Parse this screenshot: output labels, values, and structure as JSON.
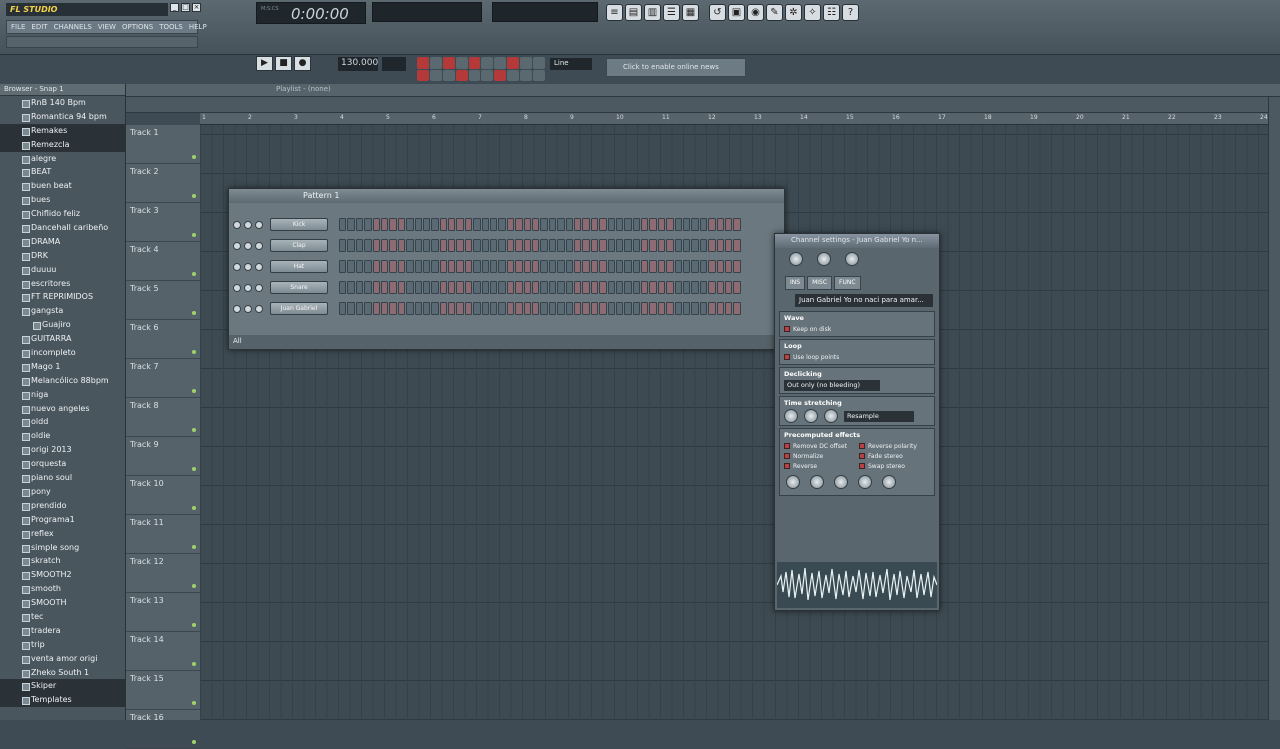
{
  "app": {
    "title": "FL STUDIO",
    "menu": [
      "FILE",
      "EDIT",
      "CHANNELS",
      "VIEW",
      "OPTIONS",
      "TOOLS",
      "HELP"
    ],
    "time": "0:00:00"
  },
  "toolbar": {
    "tempo": "130.000",
    "line_mode": "Line",
    "hint": "Click to enable online news"
  },
  "browser": {
    "title": "Browser - Snap 1",
    "items": [
      {
        "label": "RnB 140 Bpm",
        "type": "file"
      },
      {
        "label": "Romantica 94 bpm",
        "type": "file"
      },
      {
        "label": "Remakes",
        "type": "folder",
        "highlight": true
      },
      {
        "label": "Remezcla",
        "type": "folder",
        "highlight": true
      },
      {
        "label": "alegre",
        "type": "file"
      },
      {
        "label": "BEAT",
        "type": "file"
      },
      {
        "label": "buen beat",
        "type": "file"
      },
      {
        "label": "bues",
        "type": "file"
      },
      {
        "label": "Chiflido feliz",
        "type": "file"
      },
      {
        "label": "Dancehall caribeño",
        "type": "file"
      },
      {
        "label": "DRAMA",
        "type": "file"
      },
      {
        "label": "DRK",
        "type": "file"
      },
      {
        "label": "duuuu",
        "type": "file"
      },
      {
        "label": "escritores",
        "type": "file"
      },
      {
        "label": "FT REPRIMIDOS",
        "type": "file"
      },
      {
        "label": "gangsta",
        "type": "file"
      },
      {
        "label": "Guajiro",
        "type": "file",
        "sub": true
      },
      {
        "label": "GUITARRA",
        "type": "file"
      },
      {
        "label": "incompleto",
        "type": "file"
      },
      {
        "label": "Mago 1",
        "type": "file"
      },
      {
        "label": "Melancólico 88bpm",
        "type": "file"
      },
      {
        "label": "niga",
        "type": "file"
      },
      {
        "label": "nuevo angeles",
        "type": "file"
      },
      {
        "label": "oldd",
        "type": "file"
      },
      {
        "label": "oldie",
        "type": "file"
      },
      {
        "label": "origi 2013",
        "type": "file"
      },
      {
        "label": "orquesta",
        "type": "file"
      },
      {
        "label": "piano soul",
        "type": "file"
      },
      {
        "label": "pony",
        "type": "file"
      },
      {
        "label": "prendido",
        "type": "file"
      },
      {
        "label": "Programa1",
        "type": "file"
      },
      {
        "label": "reflex",
        "type": "file"
      },
      {
        "label": "simple song",
        "type": "file"
      },
      {
        "label": "skratch",
        "type": "file"
      },
      {
        "label": "SMOOTH2",
        "type": "file"
      },
      {
        "label": "smooth",
        "type": "file"
      },
      {
        "label": "SMOOTH",
        "type": "file"
      },
      {
        "label": "tec",
        "type": "file"
      },
      {
        "label": "tradera",
        "type": "file"
      },
      {
        "label": "trip",
        "type": "file"
      },
      {
        "label": "venta amor origi",
        "type": "file"
      },
      {
        "label": "Zheko South 1",
        "type": "file"
      },
      {
        "label": "Skiper",
        "type": "folder",
        "highlight": true
      },
      {
        "label": "Templates",
        "type": "folder",
        "highlight": true
      }
    ]
  },
  "playlist": {
    "title": "Playlist - (none)",
    "ruler": [
      "1",
      "2",
      "3",
      "4",
      "5",
      "6",
      "7",
      "8",
      "9",
      "10",
      "11",
      "12",
      "13",
      "14",
      "15",
      "16",
      "17",
      "18",
      "19",
      "20",
      "21",
      "22",
      "23",
      "24"
    ],
    "tracks": [
      "Track 1",
      "Track 2",
      "Track 3",
      "Track 4",
      "Track 5",
      "Track 6",
      "Track 7",
      "Track 8",
      "Track 9",
      "Track 10",
      "Track 11",
      "Track 12",
      "Track 13",
      "Track 14",
      "Track 15",
      "Track 16"
    ]
  },
  "step_sequencer": {
    "pattern": "Pattern 1",
    "filter": "All",
    "channels": [
      {
        "name": "Kick"
      },
      {
        "name": "Clap"
      },
      {
        "name": "Hat"
      },
      {
        "name": "Snare"
      },
      {
        "name": "Juan Gabriel"
      }
    ]
  },
  "channel_settings": {
    "title": "Channel settings - Juan Gabriel  Yo n...",
    "tabs": [
      "INS",
      "MISC",
      "FUNC"
    ],
    "sample_name": "Juan Gabriel  Yo no naci para amar...",
    "wave_section": "Wave",
    "keep_on_disk": "Keep on disk",
    "loop_section": "Loop",
    "loop_points": "Use loop points",
    "declicking_section": "Declicking",
    "declicking_value": "Out only (no bleeding)",
    "time_stretch_section": "Time stretching",
    "time_stretch_value": "Resample",
    "precomputed_section": "Precomputed effects",
    "effects": [
      "Remove DC offset",
      "Reverse polarity",
      "Normalize",
      "Fade stereo",
      "Reverse",
      "Swap stereo"
    ]
  }
}
